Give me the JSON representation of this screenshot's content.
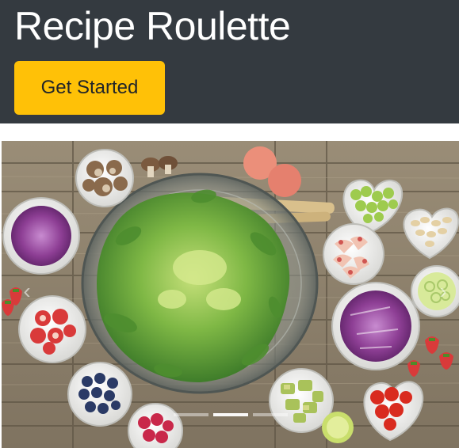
{
  "hero": {
    "title": "Recipe Roulette",
    "cta_label": "Get Started",
    "background_color": "#343a40",
    "cta_color": "#ffc107"
  },
  "carousel": {
    "slide_image": "vegetables-salad-photo",
    "prev_icon": "chevron-left-icon",
    "next_icon": "chevron-right-icon",
    "prev_glyph": "‹",
    "next_glyph": "›",
    "slide_count": 3,
    "active_slide": 2
  }
}
